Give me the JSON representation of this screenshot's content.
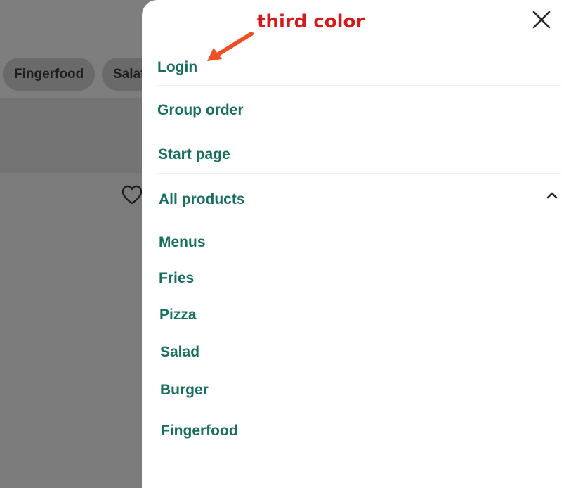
{
  "background": {
    "chips": [
      "Fingerfood",
      "Salat"
    ],
    "icons": [
      "heart-icon"
    ]
  },
  "drawer": {
    "close_icon": "close-icon",
    "items": {
      "login": "Login",
      "group_order": "Group order",
      "start_page": "Start page",
      "all_products": "All products"
    },
    "all_products_expanded": true,
    "sub_items": [
      "Menus",
      "Fries",
      "Pizza",
      "Salad",
      "Burger",
      "Fingerfood"
    ]
  },
  "annotation": {
    "label": "third color",
    "color": "#d6191a",
    "arrow_color": "#f04e23"
  },
  "colors": {
    "menu_text": "#17705e",
    "overlay": "#7b7b7b",
    "drawer_bg": "#ffffff"
  }
}
